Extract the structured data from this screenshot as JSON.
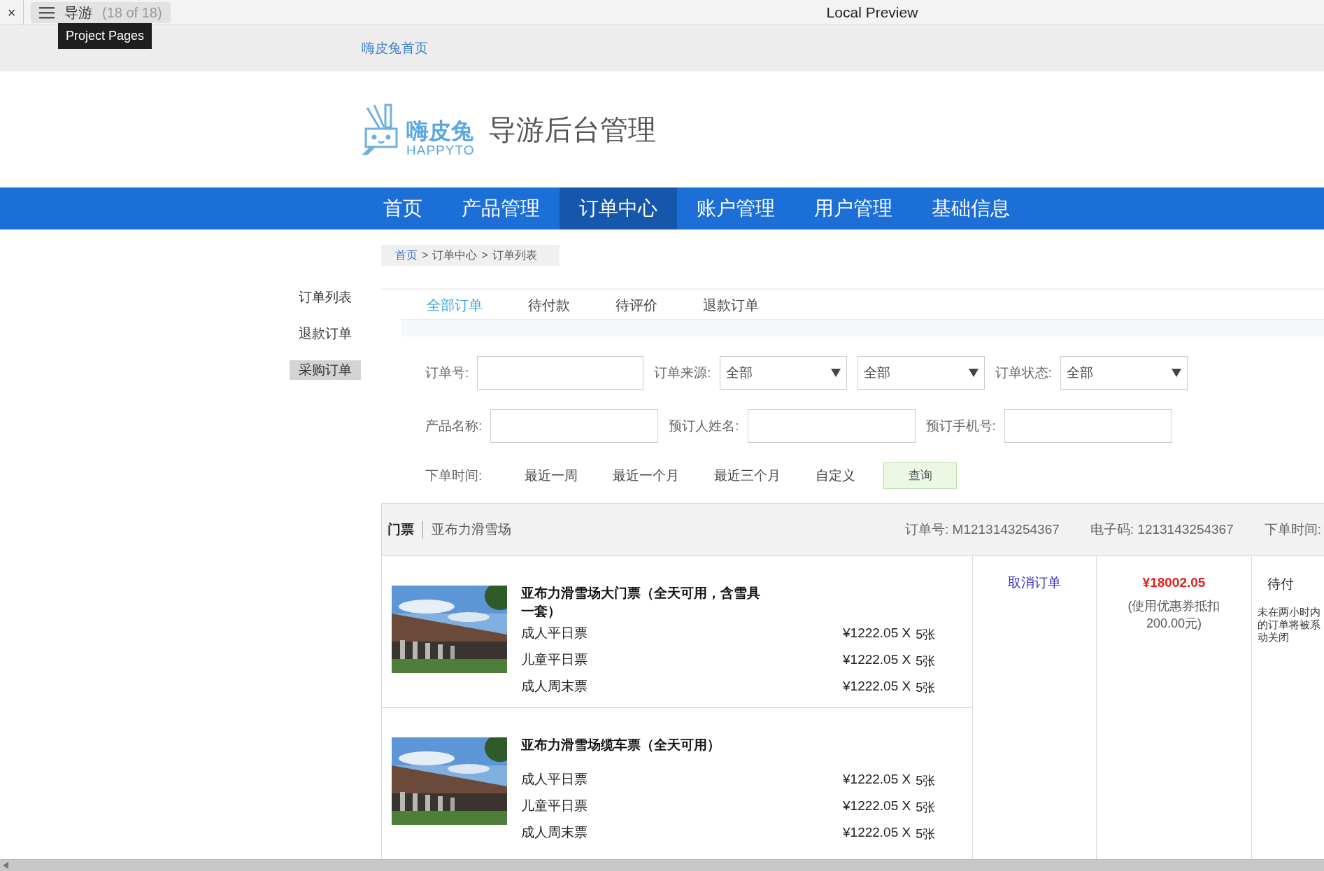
{
  "browser_bar": {
    "close": "×",
    "tab_label": "导游",
    "tab_count": "(18 of 18)",
    "title": "Local Preview",
    "tooltip": "Project Pages"
  },
  "top_link": "嗨皮兔首页",
  "header": {
    "logo_name": "嗨皮兔",
    "logo_sub": "HAPPYTO",
    "title": "导游后台管理"
  },
  "nav": [
    {
      "label": "首页",
      "selected": false
    },
    {
      "label": "产品管理",
      "selected": false
    },
    {
      "label": "订单中心",
      "selected": true
    },
    {
      "label": "账户管理",
      "selected": false
    },
    {
      "label": "用户管理",
      "selected": false
    },
    {
      "label": "基础信息",
      "selected": false
    }
  ],
  "breadcrumb": {
    "items": [
      "首页",
      "订单中心",
      "订单列表"
    ],
    "separators": [
      ">",
      ">"
    ]
  },
  "sidebar": [
    {
      "label": "订单列表",
      "selected": false
    },
    {
      "label": "退款订单",
      "selected": false
    },
    {
      "label": "采购订单",
      "selected": true
    }
  ],
  "tabs": [
    {
      "label": "全部订单",
      "selected": true
    },
    {
      "label": "待付款",
      "selected": false
    },
    {
      "label": "待评价",
      "selected": false
    },
    {
      "label": "退款订单",
      "selected": false
    }
  ],
  "filters": [
    [
      {
        "kind": "input",
        "label": "订单号:"
      },
      {
        "kind": "select",
        "label": "订单来源:",
        "value": "全部"
      },
      {
        "kind": "select",
        "value": "全部"
      },
      {
        "kind": "select",
        "label": "订单状态:",
        "value": "全部"
      }
    ],
    [
      {
        "kind": "input",
        "label": "产品名称:"
      },
      {
        "kind": "input",
        "label": "预订人姓名:"
      },
      {
        "kind": "input",
        "label": "预订手机号:"
      }
    ]
  ],
  "time_filter": {
    "label": "下单时间:",
    "options": [
      "最近一周",
      "最近一个月",
      "最近三个月",
      "自定义"
    ],
    "button": "查询"
  },
  "order": {
    "category": "门票",
    "venue": "亚布力滑雪场",
    "order_no_label": "订单号:",
    "order_no": "M1213143254367",
    "code_label": "电子码:",
    "code": "1213143254367",
    "time_label": "下单时间:",
    "products": [
      {
        "name": "亚布力滑雪场大门票（全天可用，含雪具一套）",
        "tickets": [
          {
            "name": "成人平日票",
            "price": "¥1222.05 X",
            "qty": "5张"
          },
          {
            "name": "儿童平日票",
            "price": "¥1222.05 X",
            "qty": "5张"
          },
          {
            "name": "成人周末票",
            "price": "¥1222.05 X",
            "qty": "5张"
          }
        ]
      },
      {
        "name": "亚布力滑雪场缆车票（全天可用）",
        "tickets": [
          {
            "name": "成人平日票",
            "price": "¥1222.05 X",
            "qty": "5张"
          },
          {
            "name": "儿童平日票",
            "price": "¥1222.05 X",
            "qty": "5张"
          },
          {
            "name": "成人周末票",
            "price": "¥1222.05 X",
            "qty": "5张"
          }
        ]
      }
    ],
    "action": "取消订单",
    "total": "¥18002.05",
    "discount": "(使用优惠券抵扣200.00元)",
    "status": "待付",
    "status_note": [
      "未在两小时内",
      "的订单将被系",
      "动关闭"
    ]
  }
}
